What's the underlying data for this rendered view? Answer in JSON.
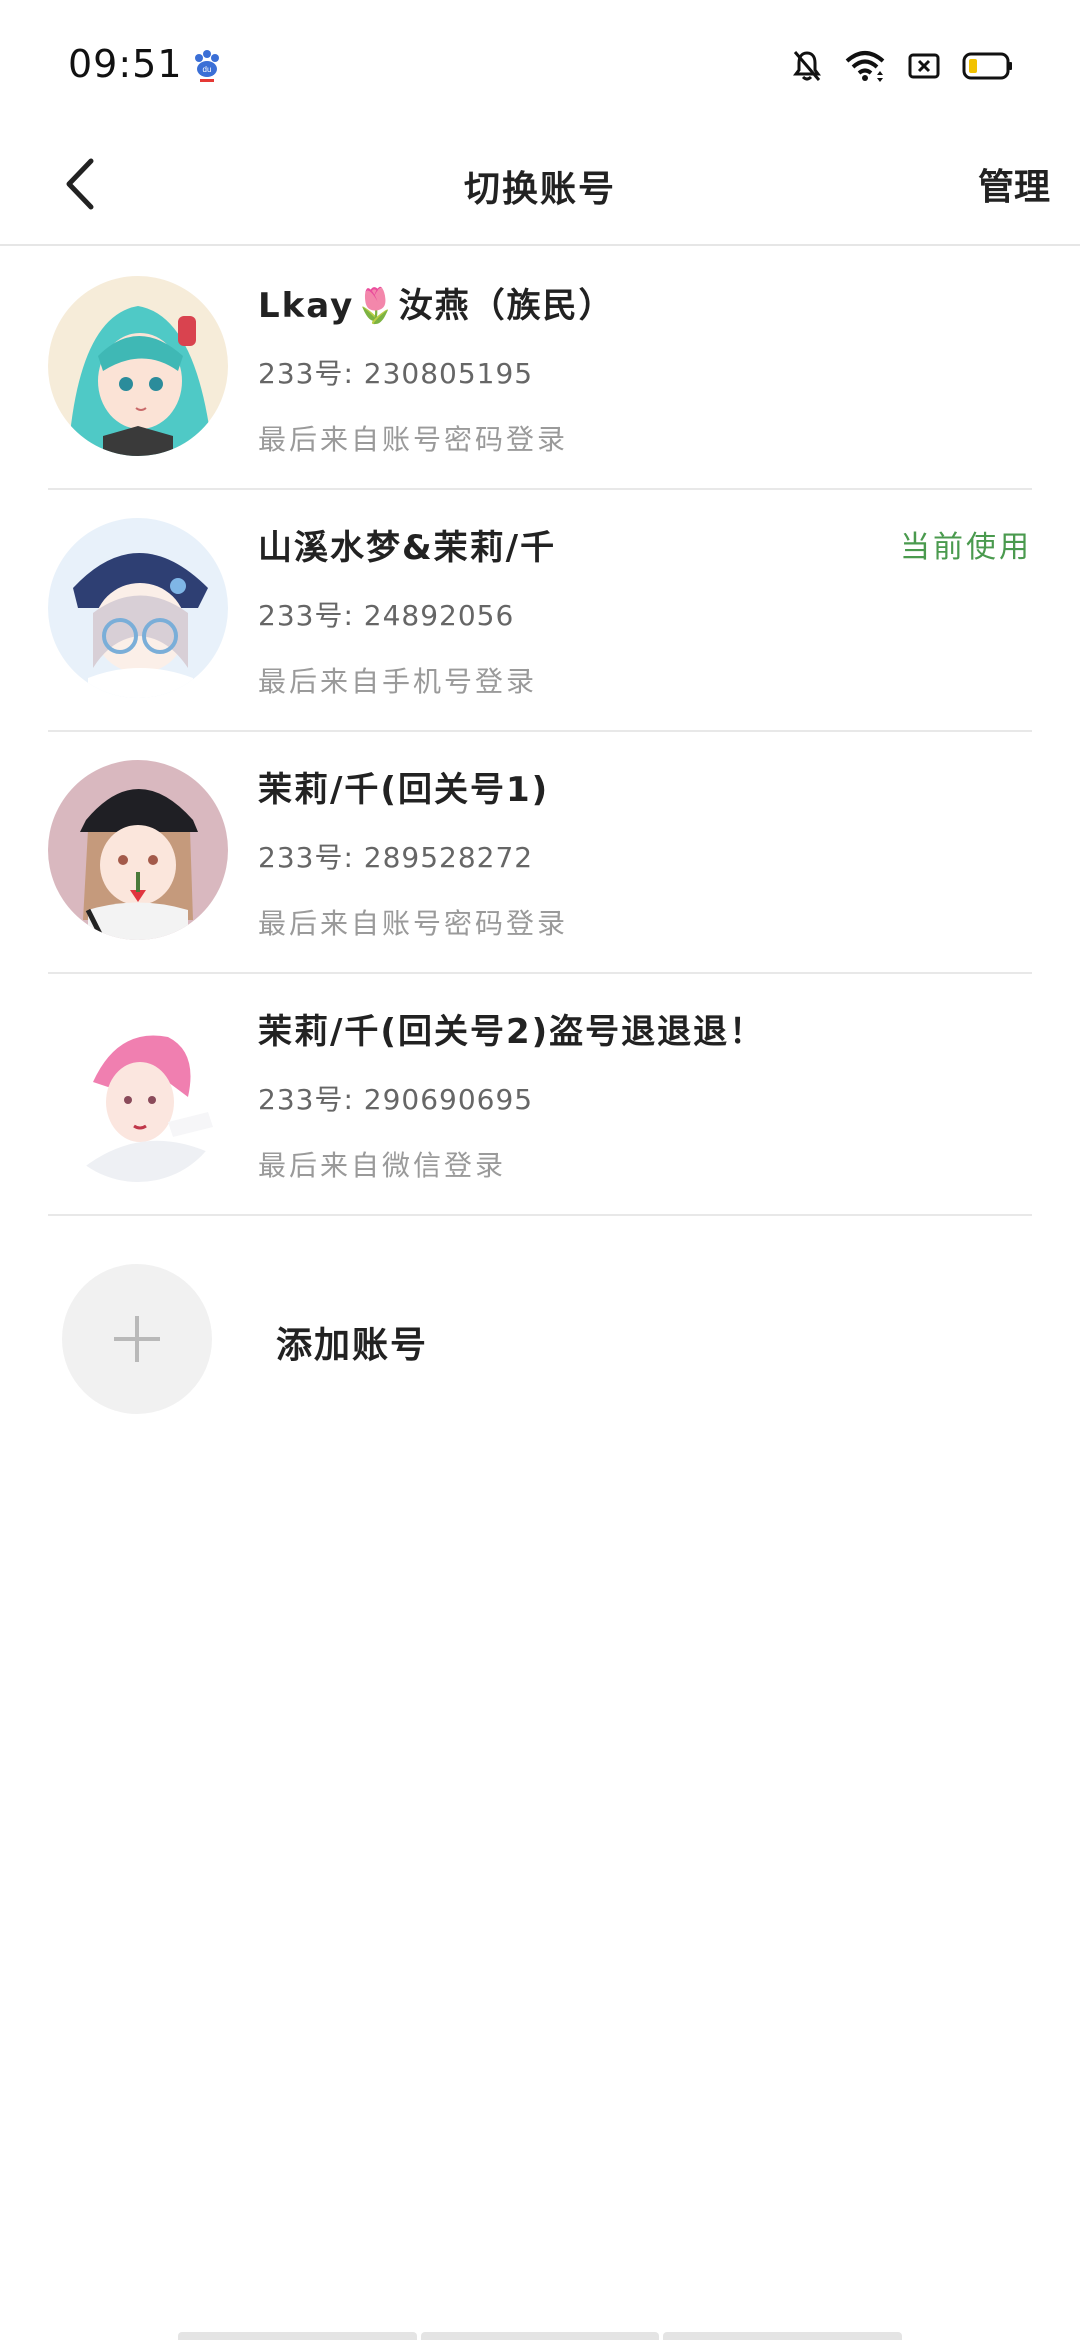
{
  "status_bar": {
    "time": "09:51",
    "icons": [
      "baidu-paw-icon",
      "bell-muted-icon",
      "wifi-icon",
      "sim-off-icon",
      "battery-low-icon"
    ],
    "battery_color": "#f2c200"
  },
  "nav": {
    "title": "切换账号",
    "manage_label": "管理",
    "back_icon": "chevron-left-icon"
  },
  "accounts": [
    {
      "name": "Lkay🌷汝燕（族民）",
      "id_text": "233号: 230805195",
      "login_method": "最后来自账号密码登录",
      "current": ""
    },
    {
      "name": "山溪水梦&茉莉/千",
      "id_text": "233号: 24892056",
      "login_method": "最后来自手机号登录",
      "current": "当前使用"
    },
    {
      "name": "茉莉/千(回关号1)",
      "id_text": "233号: 289528272",
      "login_method": "最后来自账号密码登录",
      "current": ""
    },
    {
      "name": "茉莉/千(回关号2)盗号退退退！",
      "id_text": "233号: 290690695",
      "login_method": "最后来自微信登录",
      "current": ""
    }
  ],
  "add_account": {
    "label": "添加账号",
    "icon": "plus-icon"
  },
  "colors": {
    "accent_green": "#4a9a4e",
    "divider": "#e8e8e8"
  }
}
